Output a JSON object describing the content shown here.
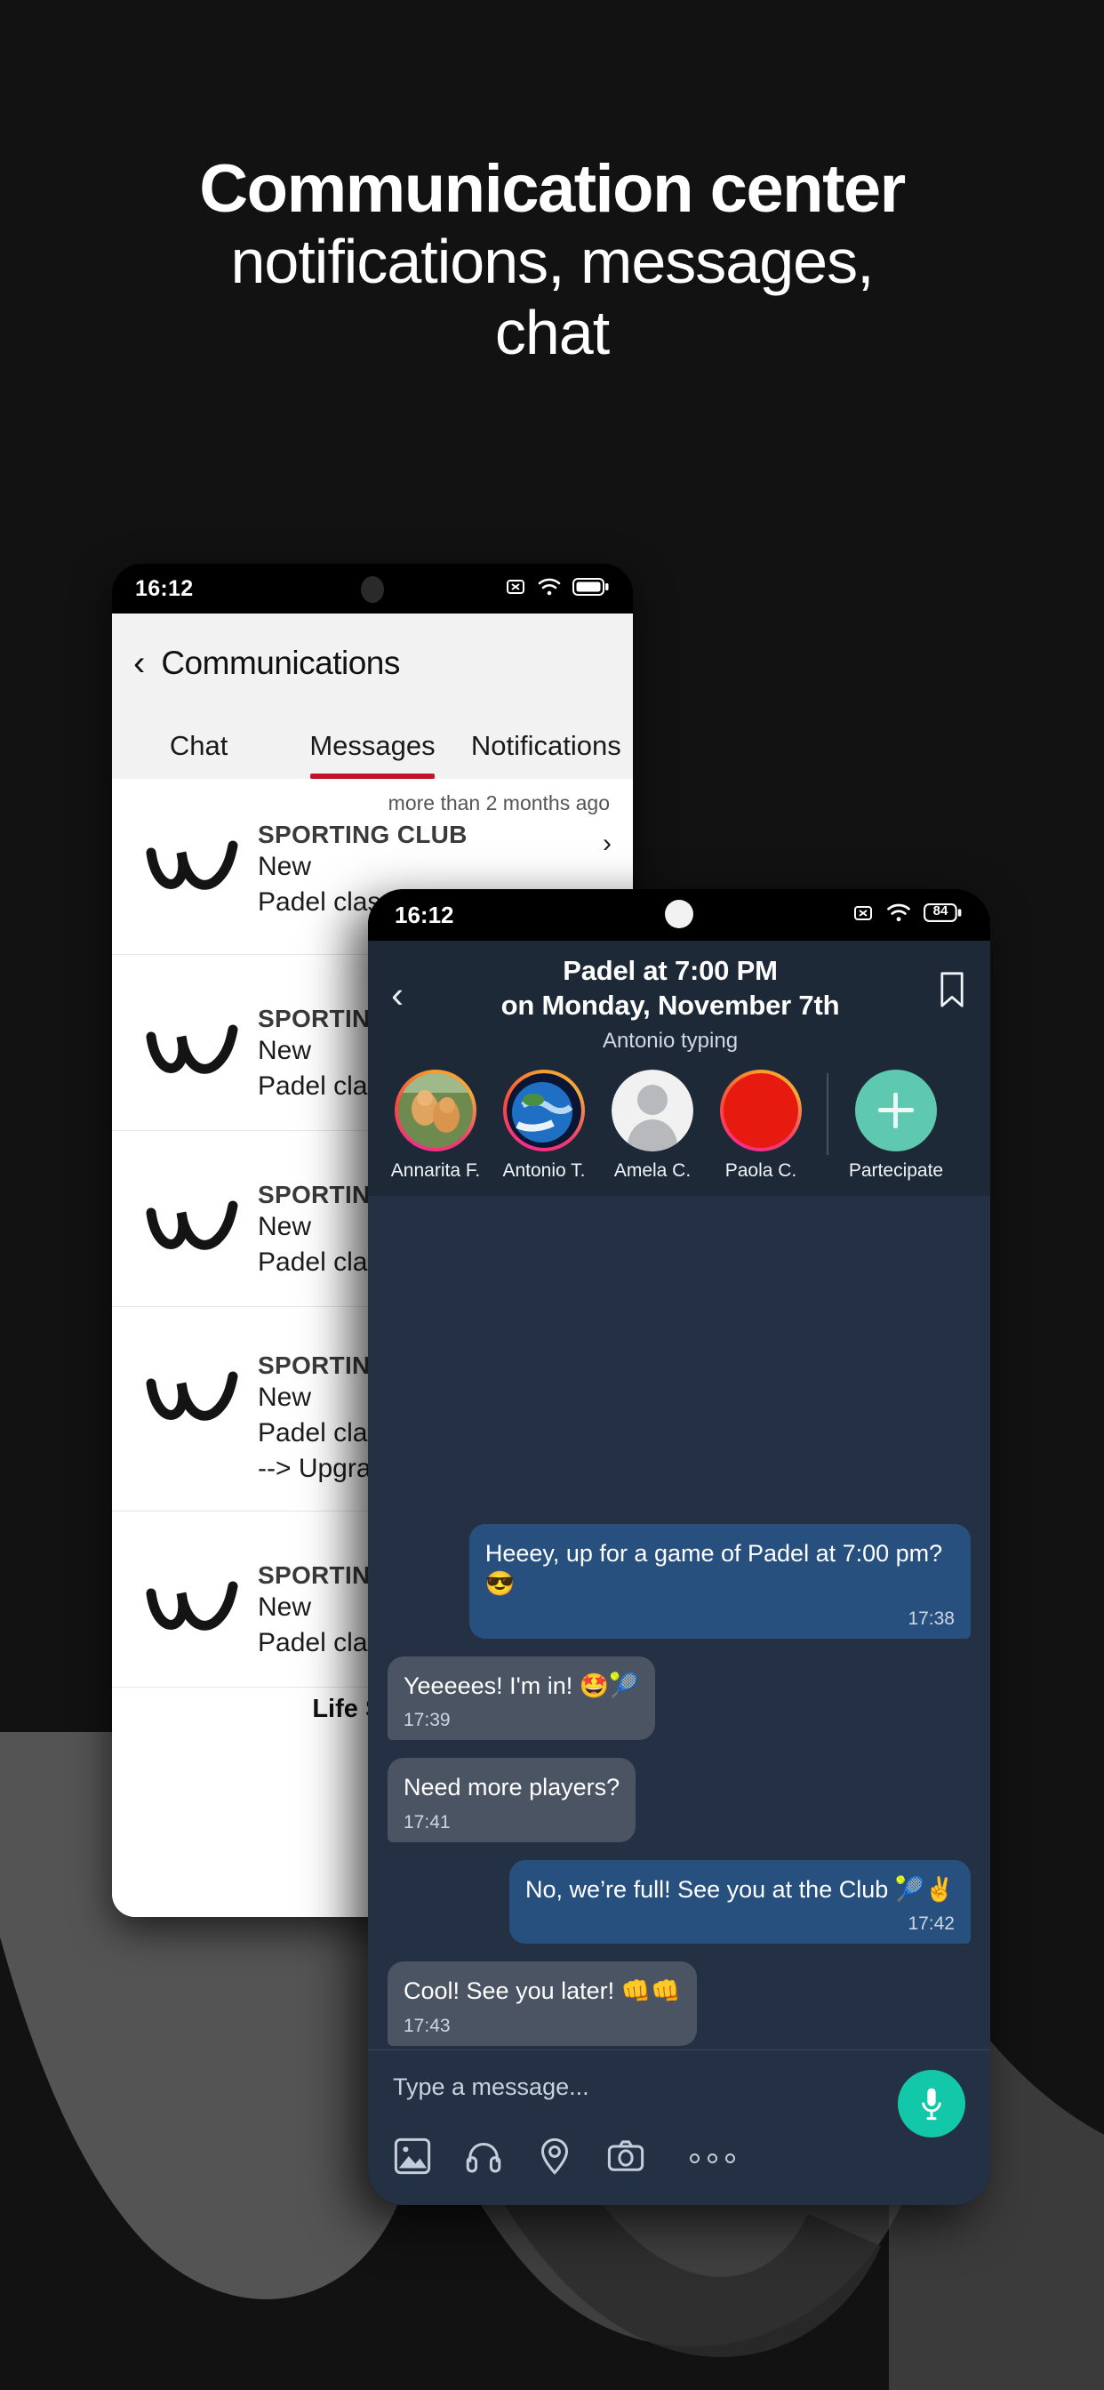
{
  "headline": {
    "line1": "Communication center",
    "line2": "notifications, messages,",
    "line3": "chat"
  },
  "colors": {
    "page_background": "#121212",
    "accent_tab_underline": "#c0142a",
    "accent_join": "#5ec9b0",
    "accent_mic": "#12c8a8",
    "bubble_out": "#27507f",
    "bubble_in": "#4a5463",
    "chat_background": "#243043"
  },
  "phone_back": {
    "status_bar": {
      "time": "16:12",
      "battery_level": "84",
      "icons": [
        "sim-off-icon",
        "wifi-icon",
        "battery-icon"
      ]
    },
    "app_bar": {
      "back_label": "‹",
      "title": "Communications"
    },
    "tabs": [
      {
        "label": "Chat",
        "active": false
      },
      {
        "label": "Messages",
        "active": true
      },
      {
        "label": "Notifications",
        "active": false
      }
    ],
    "list": [
      {
        "ago": "more than 2 months ago",
        "club": "SPORTING CLUB",
        "line1": "New",
        "line2": "Padel class",
        "line3": ""
      },
      {
        "ago": "",
        "club": "SPORTING CLUB",
        "line1": "New",
        "line2": "Padel class",
        "line3": ""
      },
      {
        "ago": "",
        "club": "SPORTING CLUB",
        "line1": "New",
        "line2": "Padel class",
        "line3": ""
      },
      {
        "ago": "",
        "club": "SPORTING CLUB",
        "line1": "New",
        "line2": "Padel class",
        "line3": "--> Upgrade"
      },
      {
        "ago": "",
        "club": "SPORTING CLUB",
        "line1": "New",
        "line2": "Padel class",
        "line3": ""
      }
    ],
    "footer_text": "Life Sport"
  },
  "phone_front": {
    "status_bar": {
      "time": "16:12",
      "battery_level": "84",
      "icons": [
        "sim-off-icon",
        "wifi-icon",
        "battery-icon"
      ]
    },
    "header": {
      "back_label": "‹",
      "title_line1": "Padel at 7:00 PM",
      "title_line2": "on Monday, November 7th",
      "typing_status": "Antonio  typing",
      "bookmark_icon": "bookmark-icon"
    },
    "participants": [
      {
        "name": "Annarita F.",
        "avatar_type": "photo-dogs",
        "ring": true
      },
      {
        "name": "Antonio T.",
        "avatar_type": "photo-earth",
        "ring": true
      },
      {
        "name": "Amela C.",
        "avatar_type": "placeholder-person",
        "ring": false
      },
      {
        "name": "Paola C.",
        "avatar_type": "solid-red",
        "ring": true
      }
    ],
    "join_button": {
      "label": "Partecipate",
      "icon": "plus-icon"
    },
    "messages": [
      {
        "side": "out",
        "text": "Heeey, up for a game of Padel at 7:00 pm? 😎",
        "time": "17:38"
      },
      {
        "side": "in",
        "text": "Yeeeees! I'm in! 🤩🎾",
        "time": "17:39"
      },
      {
        "side": "in",
        "text": "Need more players?",
        "time": "17:41"
      },
      {
        "side": "out",
        "text": "No, we’re full! See you at the Club 🎾✌️",
        "time": "17:42"
      },
      {
        "side": "in",
        "text": "Cool! See you later! 👊👊",
        "time": "17:43"
      }
    ],
    "composer": {
      "placeholder": "Type a message...",
      "mic_icon": "microphone-icon",
      "tools": [
        "image-icon",
        "headphones-icon",
        "location-pin-icon",
        "camera-icon",
        "more-options-icon"
      ]
    }
  }
}
